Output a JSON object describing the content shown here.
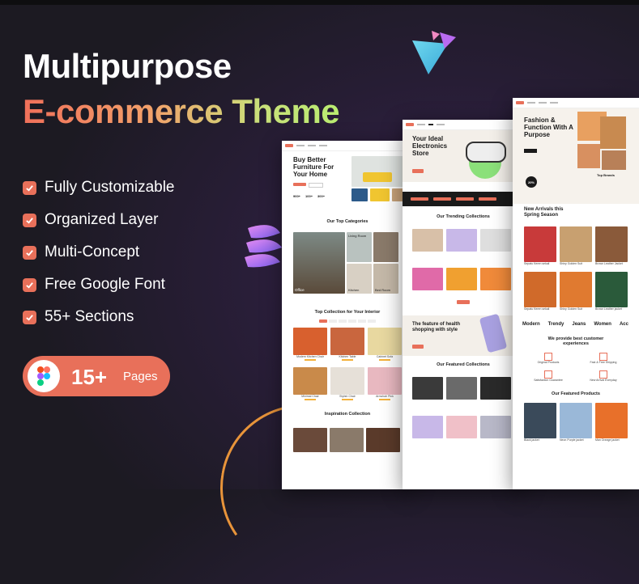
{
  "headline": {
    "line1": "Multipurpose",
    "line2": "E-commerce Theme"
  },
  "features": [
    {
      "label": "Fully Customizable"
    },
    {
      "label": "Organized Layer"
    },
    {
      "label": "Multi-Concept"
    },
    {
      "label": "Free Google Font"
    },
    {
      "label": "55+ Sections"
    }
  ],
  "pages_badge": {
    "count": "15+",
    "label": "Pages",
    "icon": "figma-icon"
  },
  "mockups": {
    "furniture": {
      "hero_title": "Buy Better Furniture For Your Home",
      "stats": [
        "900+",
        "100+",
        "300+"
      ],
      "section_categories": "Our Top Categories",
      "category_labels": [
        "Office",
        "Living Room",
        "Kitchen",
        "Bed Room"
      ],
      "section_collection": "Top Collection for Your Interior",
      "product_names": [
        "Modern Kitchen Chair",
        "Kitchen Table",
        "Cabinet Sofa",
        "Minimal Chair",
        "Stylish Chair",
        "Armchair Pink"
      ],
      "section_inspiration": "Inspiration Collection"
    },
    "electronics": {
      "hero_title": "Your Ideal Electronics Store",
      "section_trending": "Our Trending Collections",
      "feature_title": "The feature of health shopping with style",
      "section_featured": "Our Featured Collections"
    },
    "fashion": {
      "hero_title": "Fashion & Function With A Purpose",
      "discount": "20%",
      "brands_title": "Top Brands",
      "new_arrivals": "New Arrivals this Spring Season",
      "product_names": [
        "Sepatu Keren sekali",
        "Shiny Golden Suit",
        "Brown Leather Jacket",
        "Sepatu Keren sekali",
        "Shiny Golden Suit",
        "Brown Leather jacket"
      ],
      "ticker": [
        "Modern",
        "Trendy",
        "Jeans",
        "Women",
        "Acc"
      ],
      "service_title": "We provide best customer experiences",
      "services": [
        "Original Products",
        "Fast & Free Shipping",
        "Satisfaction Guarantee",
        "New Arrival Everyday"
      ],
      "section_featured": "Our Featured Products",
      "featured_names": [
        "Black jacket",
        "Neon Purple jacket",
        "Man Orange jacket"
      ]
    }
  },
  "colors": {
    "accent": "#e8705a",
    "background": "#1c1a22",
    "gradient_start": "#f0705a",
    "gradient_end": "#b9ec70"
  }
}
